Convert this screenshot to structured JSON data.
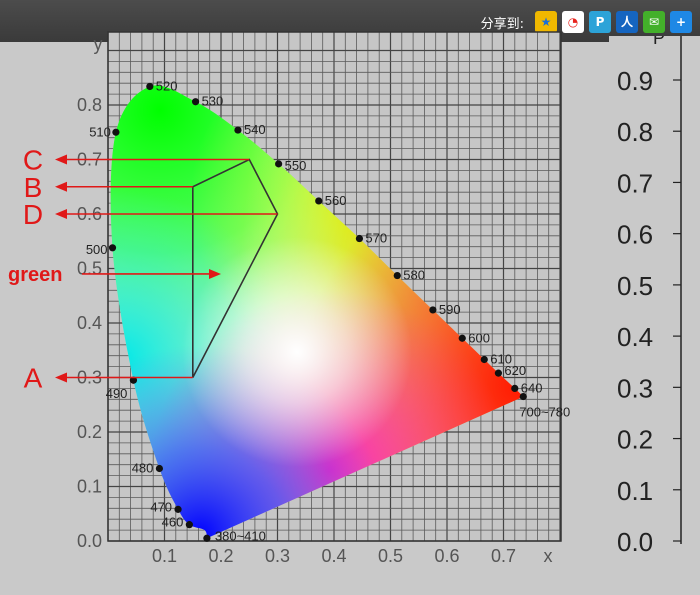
{
  "share": {
    "label": "分享到:",
    "buttons": [
      {
        "name": "qzone-share-icon",
        "glyph": "★",
        "bg": "#f0b800",
        "fg": "#1b6fd6"
      },
      {
        "name": "weibo-share-icon",
        "glyph": "◔",
        "bg": "#ffffff",
        "fg": "#e8231d"
      },
      {
        "name": "tencent-weibo-share-icon",
        "glyph": "P",
        "bg": "#2ca3d8",
        "fg": "#ffffff"
      },
      {
        "name": "renren-share-icon",
        "glyph": "人",
        "bg": "#1565c0",
        "fg": "#ffffff"
      },
      {
        "name": "wechat-share-icon",
        "glyph": "✉",
        "bg": "#43b02a",
        "fg": "#ffffff"
      },
      {
        "name": "more-share-icon",
        "glyph": "+",
        "bg": "#1e88e5",
        "fg": "#ffffff"
      }
    ]
  },
  "chart_data": {
    "type": "chromaticity-diagram",
    "xlabel": "x",
    "ylabel": "y",
    "xlim": [
      0.0,
      0.8
    ],
    "ylim": [
      0.0,
      0.85
    ],
    "x_ticks": [
      {
        "value": 0.1,
        "label": "0.1"
      },
      {
        "value": 0.2,
        "label": "0.2"
      },
      {
        "value": 0.3,
        "label": "0.3"
      },
      {
        "value": 0.4,
        "label": "0.4"
      },
      {
        "value": 0.5,
        "label": "0.5"
      },
      {
        "value": 0.6,
        "label": "0.6"
      },
      {
        "value": 0.7,
        "label": "0.7"
      }
    ],
    "y_ticks": [
      {
        "value": 0.0,
        "label": "0.0"
      },
      {
        "value": 0.1,
        "label": "0.1"
      },
      {
        "value": 0.2,
        "label": "0.2"
      },
      {
        "value": 0.3,
        "label": "0.3"
      },
      {
        "value": 0.4,
        "label": "0.4"
      },
      {
        "value": 0.5,
        "label": "0.5"
      },
      {
        "value": 0.6,
        "label": "0.6"
      },
      {
        "value": 0.7,
        "label": "0.7"
      },
      {
        "value": 0.8,
        "label": "0.8"
      }
    ],
    "right_axis_ticks": [
      "0.0",
      "0.1",
      "0.2",
      "0.3",
      "0.4",
      "0.5",
      "0.6",
      "0.7",
      "0.8",
      "0.9"
    ],
    "right_axis_label_partial": "P",
    "spectral_locus": [
      {
        "x": 0.175,
        "y": 0.005,
        "label": "380~410"
      },
      {
        "x": 0.171,
        "y": 0.02
      },
      {
        "x": 0.144,
        "y": 0.03,
        "label": "460"
      },
      {
        "x": 0.124,
        "y": 0.058,
        "label": "470"
      },
      {
        "x": 0.091,
        "y": 0.133,
        "label": "480"
      },
      {
        "x": 0.045,
        "y": 0.295,
        "label": "490"
      },
      {
        "x": 0.008,
        "y": 0.538,
        "label": "500"
      },
      {
        "x": 0.014,
        "y": 0.75,
        "label": "510"
      },
      {
        "x": 0.074,
        "y": 0.834,
        "label": "520"
      },
      {
        "x": 0.155,
        "y": 0.806,
        "label": "530"
      },
      {
        "x": 0.23,
        "y": 0.754,
        "label": "540"
      },
      {
        "x": 0.302,
        "y": 0.692,
        "label": "550"
      },
      {
        "x": 0.373,
        "y": 0.624,
        "label": "560"
      },
      {
        "x": 0.445,
        "y": 0.555,
        "label": "570"
      },
      {
        "x": 0.512,
        "y": 0.487,
        "label": "580"
      },
      {
        "x": 0.575,
        "y": 0.424,
        "label": "590"
      },
      {
        "x": 0.627,
        "y": 0.372,
        "label": "600"
      },
      {
        "x": 0.666,
        "y": 0.333,
        "label": "610"
      },
      {
        "x": 0.691,
        "y": 0.308,
        "label": "620"
      },
      {
        "x": 0.72,
        "y": 0.28,
        "label": "640"
      },
      {
        "x": 0.735,
        "y": 0.265,
        "label": "700~780"
      }
    ],
    "region": {
      "name": "green",
      "vertices": [
        {
          "x": 0.15,
          "y": 0.3
        },
        {
          "x": 0.15,
          "y": 0.65
        },
        {
          "x": 0.25,
          "y": 0.7
        },
        {
          "x": 0.3,
          "y": 0.6
        }
      ]
    },
    "markers": [
      {
        "label": "A",
        "x": 0.15,
        "y": 0.3
      },
      {
        "label": "B",
        "x": 0.15,
        "y": 0.65
      },
      {
        "label": "C",
        "x": 0.25,
        "y": 0.7
      },
      {
        "label": "D",
        "x": 0.3,
        "y": 0.6
      }
    ],
    "region_label": {
      "text": "green",
      "x": 0.2,
      "y": 0.49
    },
    "annotation_color": "#e01818",
    "region_line_color": "#333333"
  }
}
